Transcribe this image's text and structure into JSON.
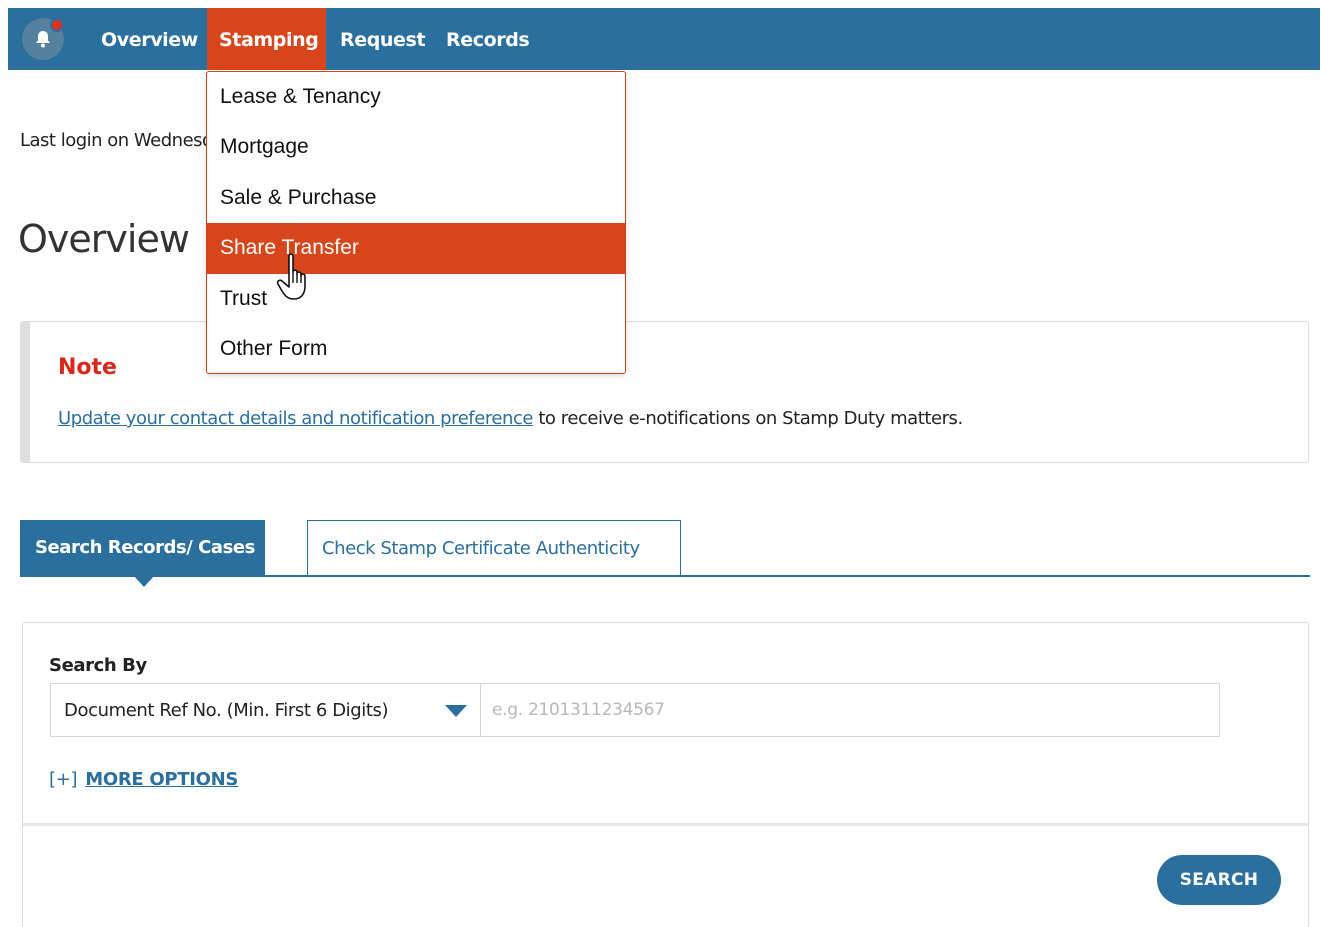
{
  "nav": {
    "items": [
      {
        "label": "Overview",
        "active": false
      },
      {
        "label": "Stamping",
        "active": true
      },
      {
        "label": "Request",
        "active": false
      },
      {
        "label": "Records",
        "active": false
      }
    ],
    "bell_icon": "bell-icon",
    "notification_dot": true
  },
  "dropdown": {
    "items": [
      "Lease & Tenancy",
      "Mortgage",
      "Sale & Purchase",
      "Share Transfer",
      "Trust",
      "Other Form"
    ],
    "highlighted": "Share Transfer"
  },
  "last_login_text": "Last login on Wednesday",
  "page_title": "Overview",
  "note": {
    "title": "Note",
    "link_text": "Update your contact details and notification preference",
    "rest_text": " to receive e-notifications on Stamp Duty matters."
  },
  "tabs": {
    "active_label": "Search Records/ Cases",
    "inactive_label": "Check Stamp Certificate Authenticity"
  },
  "search": {
    "label": "Search By",
    "selected_option": "Document Ref No. (Min. First 6 Digits)",
    "placeholder": "e.g. 2101311234567",
    "more_options_bracket": "[+]",
    "more_options_label": "MORE OPTIONS",
    "button_label": "SEARCH"
  },
  "colors": {
    "primary": "#2a6f9e",
    "accent": "#d9451b",
    "note_red": "#d9271b"
  }
}
